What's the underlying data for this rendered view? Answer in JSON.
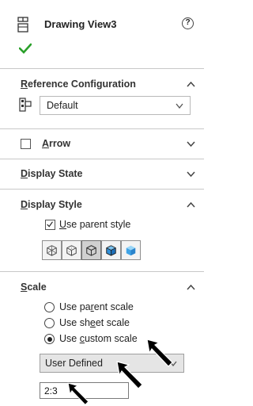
{
  "header": {
    "title": "Drawing View3",
    "help_symbol": "?",
    "icons": [
      "drawing-view-icon",
      "help-icon",
      "ok-checkmark-icon"
    ]
  },
  "reference_configuration": {
    "title_prefix": "R",
    "title_rest": "eference Configuration",
    "value": "Default"
  },
  "arrow": {
    "title_prefix": "A",
    "title_rest": "rrow",
    "checked": false
  },
  "display_state": {
    "title_prefix": "D",
    "title_rest": "isplay State"
  },
  "display_style": {
    "title_prefix": "D",
    "title_rest": "isplay Style",
    "use_parent_label_pre": "",
    "use_parent_label_ul": "U",
    "use_parent_label_post": "se parent style",
    "use_parent_checked": true,
    "buttons": [
      "wireframe",
      "hidden-lines-visible",
      "hidden-lines-removed",
      "shaded-with-edges",
      "shaded"
    ],
    "selected": "hidden-lines-removed"
  },
  "scale": {
    "title_prefix": "S",
    "title_rest": "cale",
    "options": [
      {
        "pre": "Use pa",
        "ul": "r",
        "post": "ent scale",
        "selected": false
      },
      {
        "pre": "Use sh",
        "ul": "e",
        "post": "et scale",
        "selected": false
      },
      {
        "pre": "Use ",
        "ul": "c",
        "post": "ustom scale",
        "selected": true
      }
    ],
    "preset": "User Defined",
    "custom_value": "2:3"
  },
  "colors": {
    "accent_green": "#2aa02a",
    "cursor_black": "#000000",
    "shaded_blue": "#2f8fd8"
  }
}
